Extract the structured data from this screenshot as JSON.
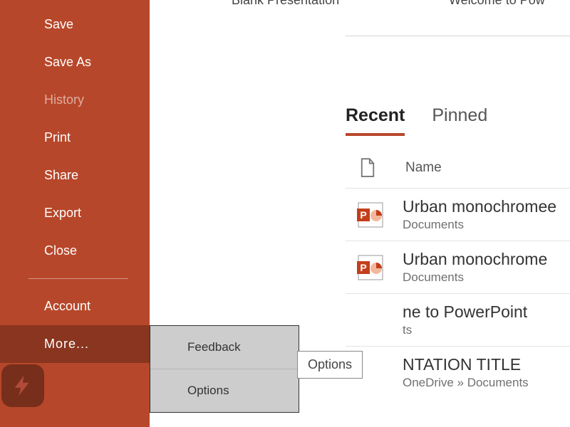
{
  "sidebar": {
    "items": [
      {
        "label": "Save"
      },
      {
        "label": "Save As"
      },
      {
        "label": "History"
      },
      {
        "label": "Print"
      },
      {
        "label": "Share"
      },
      {
        "label": "Export"
      },
      {
        "label": "Close"
      }
    ],
    "account": "Account",
    "more": "More...",
    "submenu": [
      {
        "label": "Feedback"
      },
      {
        "label": "Options"
      }
    ]
  },
  "tooltip": "Options",
  "topStrip": {
    "left": "Blank Presentation",
    "right": "Welcome to Pow"
  },
  "tabs": {
    "recent": "Recent",
    "pinned": "Pinned"
  },
  "columns": {
    "name": "Name"
  },
  "files": [
    {
      "title": "Urban monochromee",
      "location": "Documents"
    },
    {
      "title": "Urban monochrome",
      "location": "Documents"
    },
    {
      "title": "ne to PowerPoint",
      "location": "ts"
    },
    {
      "title": "NTATION TITLE",
      "location": "OneDrive » Documents"
    }
  ]
}
